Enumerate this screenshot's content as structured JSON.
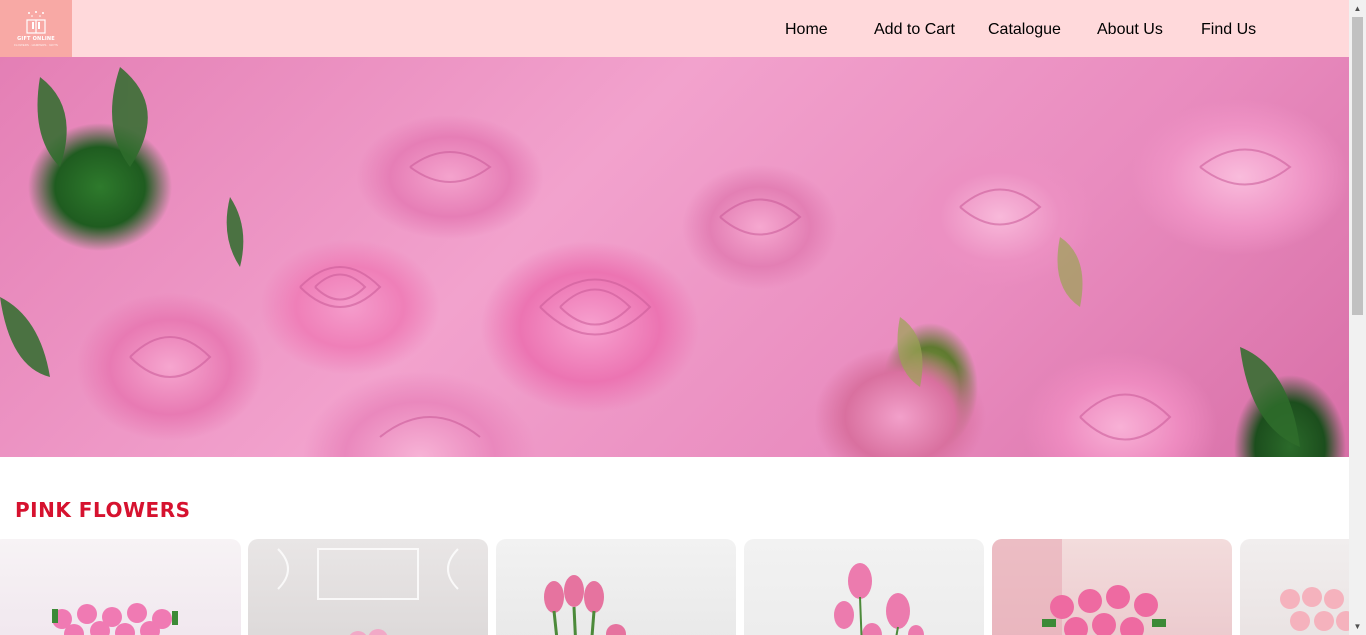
{
  "header": {
    "logo_text": "GIFT ONLINE",
    "logo_subtext": "FLOWERS · HAMPERS · GIFTS",
    "nav": {
      "home": "Home",
      "add_to_cart": "Add to Cart",
      "catalogue": "Catalogue",
      "about_us": "About Us",
      "find_us": "Find Us"
    }
  },
  "hero": {
    "image": "pink-roses-banner"
  },
  "section": {
    "title": "PINK FLOWERS"
  },
  "products": [
    {
      "image": "pink-roses-bouquet-wrapped"
    },
    {
      "image": "pink-roses-arrangement-ornate-wall"
    },
    {
      "image": "pink-roses-vase"
    },
    {
      "image": "pink-roses-bud-vase"
    },
    {
      "image": "pink-roses-bouquet-paper"
    },
    {
      "image": "light-pink-roses-bouquet"
    }
  ],
  "colors": {
    "header_bg": "#ffd9db",
    "logo_bg": "#f8a9a5",
    "nav_text": "#ffffff",
    "section_title": "#d6122f"
  }
}
